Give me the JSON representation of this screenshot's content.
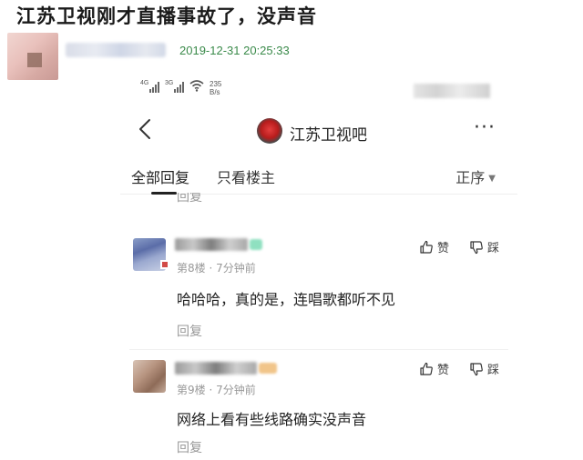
{
  "post": {
    "title": "江苏卫视刚才直播事故了，没声音",
    "timestamp": "2019-12-31 20:25:33"
  },
  "phone": {
    "status": {
      "signal1": "4G",
      "signal2": "3G",
      "speed": "235",
      "speed_unit": "B/s"
    },
    "nav": {
      "back_icon": "chevron-left-icon",
      "bar_name": "江苏卫视吧",
      "more_label": "···"
    },
    "tabs": {
      "all": "全部回复",
      "owner_only": "只看楼主",
      "sort": "正序"
    },
    "cut_off_reply": "回复",
    "comments": [
      {
        "floor_time": "第8楼 · 7分钟前",
        "text": "哈哈哈，真的是，连唱歌都听不见",
        "like_label": "赞",
        "dislike_label": "踩",
        "reply_label": "回复"
      },
      {
        "floor_time": "第9楼 · 7分钟前",
        "text": "网络上看有些线路确实没声音",
        "like_label": "赞",
        "dislike_label": "踩",
        "reply_label": "回复"
      }
    ]
  }
}
